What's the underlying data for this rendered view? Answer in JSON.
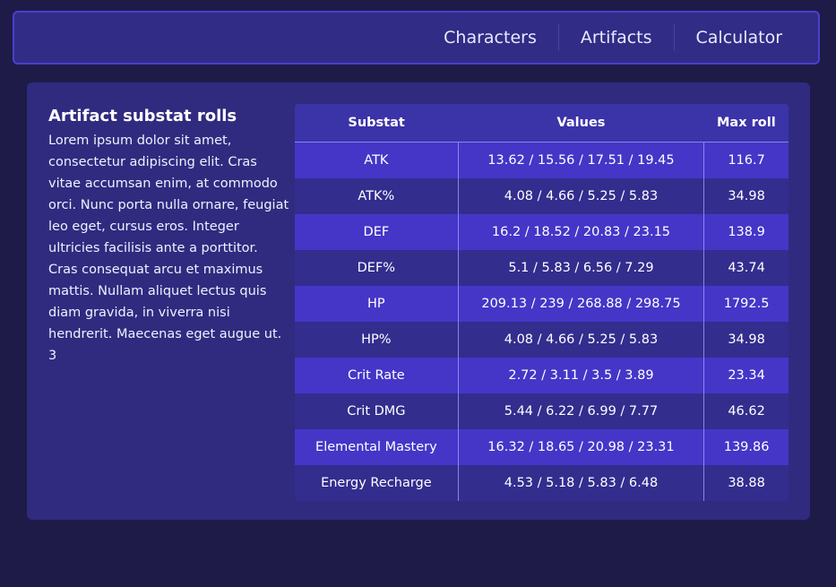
{
  "nav": {
    "items": [
      "Characters",
      "Artifacts",
      "Calculator"
    ]
  },
  "content": {
    "title": "Artifact substat rolls",
    "body": "Lorem ipsum dolor sit amet, consectetur adipiscing elit. Cras vitae accumsan enim, at commodo orci. Nunc porta nulla ornare, feugiat leo eget, cursus eros. Integer ultricies facilisis ante a porttitor. Cras consequat arcu et maximus mattis. Nullam aliquet lectus quis diam gravida, in viverra nisi hendrerit. Maecenas eget augue ut.",
    "extra": "3"
  },
  "table": {
    "headers": [
      "Substat",
      "Values",
      "Max roll"
    ],
    "rows": [
      {
        "substat": "ATK",
        "values": "13.62 / 15.56 / 17.51 / 19.45",
        "max": "116.7"
      },
      {
        "substat": "ATK%",
        "values": "4.08 / 4.66 / 5.25 / 5.83",
        "max": "34.98"
      },
      {
        "substat": "DEF",
        "values": "16.2 / 18.52 / 20.83 / 23.15",
        "max": "138.9"
      },
      {
        "substat": "DEF%",
        "values": "5.1 / 5.83 / 6.56 / 7.29",
        "max": "43.74"
      },
      {
        "substat": "HP",
        "values": "209.13 / 239 / 268.88 / 298.75",
        "max": "1792.5"
      },
      {
        "substat": "HP%",
        "values": "4.08 / 4.66 / 5.25 / 5.83",
        "max": "34.98"
      },
      {
        "substat": "Crit Rate",
        "values": "2.72 / 3.11 / 3.5 / 3.89",
        "max": "23.34"
      },
      {
        "substat": "Crit DMG",
        "values": "5.44 / 6.22 / 6.99 / 7.77",
        "max": "46.62"
      },
      {
        "substat": "Elemental Mastery",
        "values": "16.32 / 18.65 / 20.98 / 23.31",
        "max": "139.86"
      },
      {
        "substat": "Energy Recharge",
        "values": "4.53 / 5.18 / 5.83 / 6.48",
        "max": "38.88"
      }
    ]
  }
}
